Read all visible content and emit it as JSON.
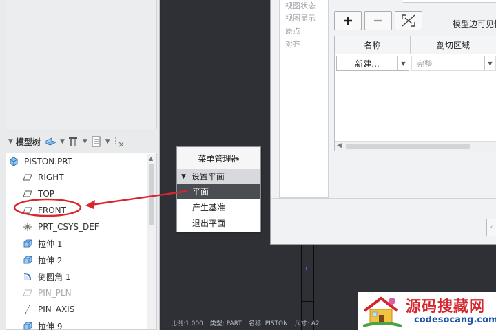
{
  "model_tree": {
    "title": "模型树",
    "items": [
      {
        "label": "PISTON.PRT",
        "icon": "part-icon",
        "indent": 0,
        "dim": false
      },
      {
        "label": "RIGHT",
        "icon": "datum-plane-icon",
        "indent": 1,
        "dim": false
      },
      {
        "label": "TOP",
        "icon": "datum-plane-icon",
        "indent": 1,
        "dim": false
      },
      {
        "label": "FRONT",
        "icon": "datum-plane-icon",
        "indent": 1,
        "dim": false
      },
      {
        "label": "PRT_CSYS_DEF",
        "icon": "csys-icon",
        "indent": 1,
        "dim": false
      },
      {
        "label": "拉伸 1",
        "icon": "extrude-icon",
        "indent": 1,
        "dim": false
      },
      {
        "label": "拉伸 2",
        "icon": "extrude-icon",
        "indent": 1,
        "dim": false
      },
      {
        "label": "倒圆角 1",
        "icon": "round-icon",
        "indent": 1,
        "dim": false
      },
      {
        "label": "PIN_PLN",
        "icon": "datum-plane-icon",
        "indent": 1,
        "dim": true
      },
      {
        "label": "PIN_AXIS",
        "icon": "axis-icon",
        "indent": 1,
        "dim": false
      },
      {
        "label": "拉伸 9",
        "icon": "extrude-icon",
        "indent": 1,
        "dim": false
      }
    ]
  },
  "view_dialog": {
    "tabs": [
      "视图状态",
      "视图显示",
      "原点",
      "对齐"
    ],
    "visible_label": "模型边可见性",
    "table": {
      "columns": [
        "名称",
        "剖切区域"
      ],
      "row": {
        "name": "新建...",
        "region": "完整"
      }
    }
  },
  "menu_manager": {
    "title": "菜单管理器",
    "section": "设置平面",
    "items": [
      "平面",
      "产生基准",
      "退出平面"
    ],
    "selected_index": 0
  },
  "status_bar": {
    "scale": "比例:1.000",
    "type": "类型: PART",
    "name": "名称: PISTON",
    "size": "尺寸: A2"
  },
  "watermark": {
    "title": "源码搜藏网",
    "url": "codesocang.com"
  },
  "colors": {
    "annotation": "#d9262c",
    "selected": "#4a4d52",
    "graphics_bg": "#2e3036"
  }
}
